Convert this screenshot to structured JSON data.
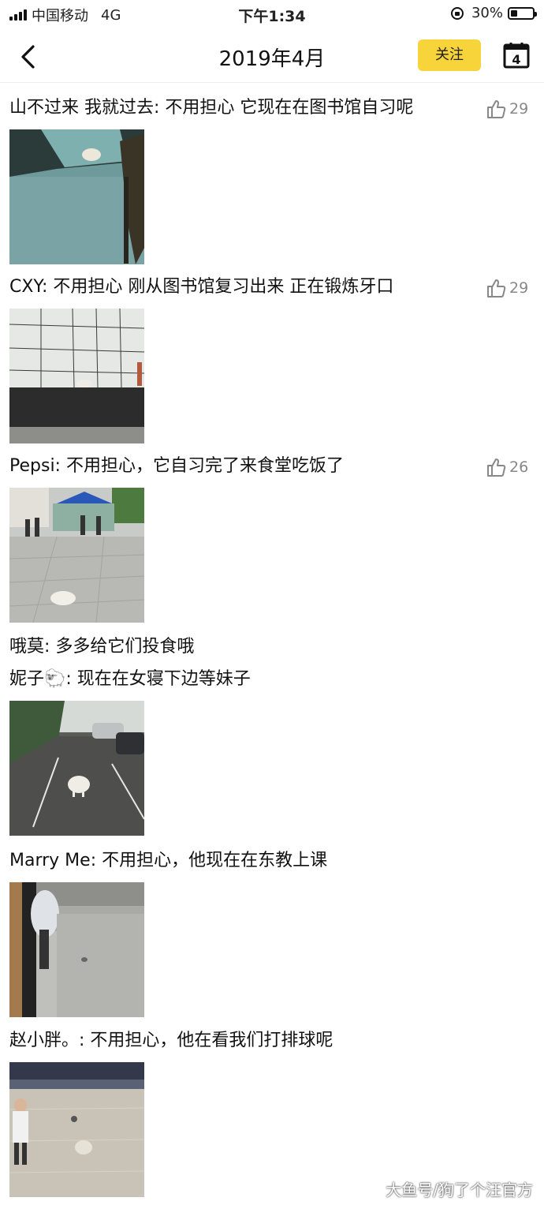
{
  "status_bar": {
    "carrier": "中国移动",
    "network": "4G",
    "time": "下午1:34",
    "battery_percent": "30%",
    "battery_level": 0.3
  },
  "nav": {
    "title": "2019年4月",
    "follow_label": "关注",
    "calendar_day": "4",
    "icons": {
      "back": "chevron-left-icon",
      "calendar": "calendar-icon"
    }
  },
  "posts": [
    {
      "text": "山不过来 我就过去: 不用担心 它现在在图书馆自习呢",
      "likes": "29"
    },
    {
      "text": "CXY: 不用担心 刚从图书馆复习出来 正在锻炼牙口",
      "likes": "29"
    },
    {
      "text": "Pepsi: 不用担心，它自习完了来食堂吃饭了",
      "likes": "26"
    },
    {
      "text": "哦莫: 多多给它们投食哦"
    },
    {
      "text": "妮子🐑: 现在在女寝下边等妹子"
    },
    {
      "text": "Marry Me: 不用担心，他现在在东教上课"
    },
    {
      "text": "赵小胖。: 不用担心，他在看我们打排球呢"
    }
  ],
  "watermark": "大鱼号/狗了个汪官方",
  "colors": {
    "accent": "#f7d43a",
    "like_gray": "#888888"
  }
}
